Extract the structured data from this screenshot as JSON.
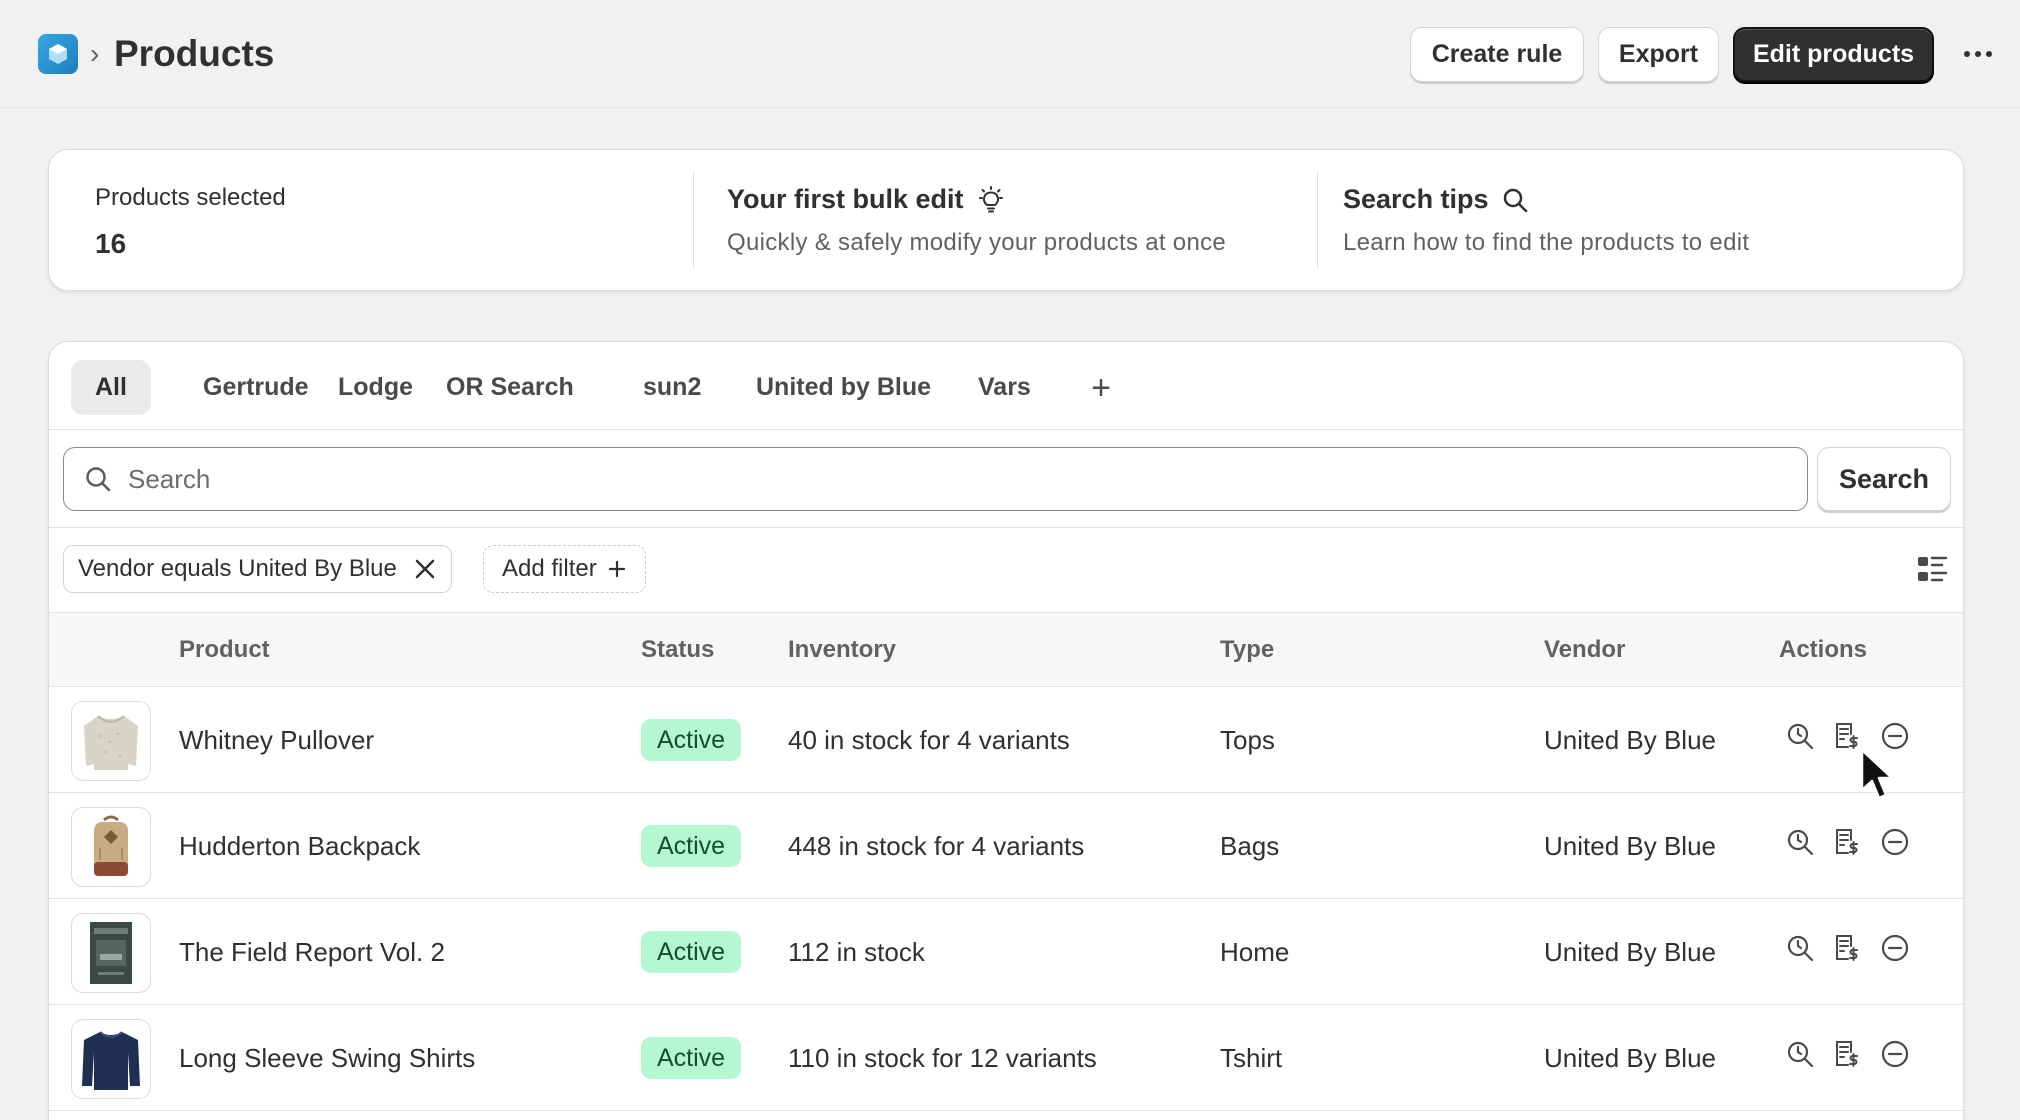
{
  "header": {
    "separator": "›",
    "title": "Products",
    "buttons": {
      "create_rule": "Create rule",
      "export": "Export",
      "edit_products": "Edit products"
    }
  },
  "info": {
    "selected_label": "Products selected",
    "selected_count": "16",
    "bulk_edit": {
      "title": "Your first bulk edit",
      "subtitle": "Quickly & safely modify your products at once"
    },
    "search_tips": {
      "title": "Search tips",
      "subtitle": "Learn how to find the products to edit"
    }
  },
  "tabs": [
    "All",
    "Gertrude",
    "Lodge",
    "OR Search",
    "sun2",
    "United by Blue",
    "Vars"
  ],
  "tab_add": "+",
  "search": {
    "placeholder": "Search",
    "button": "Search"
  },
  "filters": {
    "active": "Vendor equals United By Blue",
    "add_label": "Add filter"
  },
  "table": {
    "columns": [
      "Product",
      "Status",
      "Inventory",
      "Type",
      "Vendor",
      "Actions"
    ],
    "rows": [
      {
        "product": "Whitney Pullover",
        "status": "Active",
        "inventory": "40 in stock for 4 variants",
        "type": "Tops",
        "vendor": "United By Blue"
      },
      {
        "product": "Hudderton Backpack",
        "status": "Active",
        "inventory": "448 in stock for 4 variants",
        "type": "Bags",
        "vendor": "United By Blue"
      },
      {
        "product": "The Field Report Vol. 2",
        "status": "Active",
        "inventory": "112 in stock",
        "type": "Home",
        "vendor": "United By Blue"
      },
      {
        "product": "Long Sleeve Swing Shirts",
        "status": "Active",
        "inventory": "110 in stock for 12 variants",
        "type": "Tshirt",
        "vendor": "United By Blue"
      }
    ]
  },
  "colors": {
    "primary_button": "#303030",
    "active_badge_bg": "#b4f7d0",
    "active_badge_text": "#0c5132",
    "app_icon": "#2a93d5"
  },
  "icons": {
    "app": "app-logo-icon",
    "more": "more-horizontal-icon",
    "bulb": "lightbulb-icon",
    "search": "search-icon",
    "close": "close-icon",
    "plus": "plus-icon",
    "view": "view-toggle-icon",
    "history": "history-search-icon",
    "price": "price-list-icon",
    "remove": "remove-circle-icon"
  }
}
